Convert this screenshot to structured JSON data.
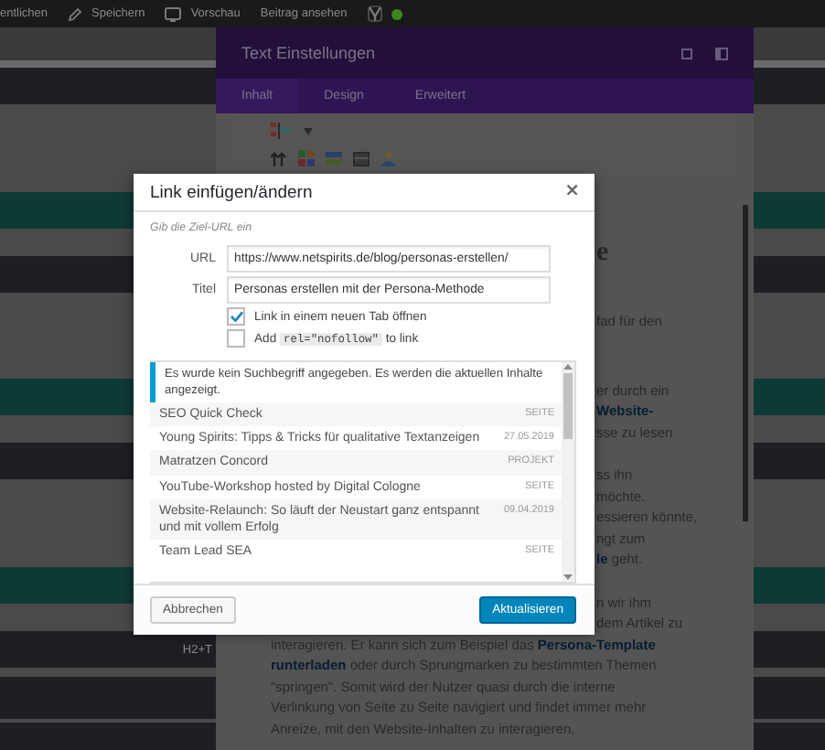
{
  "top_bar": {
    "items": [
      {
        "label": "entlichen"
      },
      {
        "label": "Speichern"
      },
      {
        "label": "Vorschau"
      },
      {
        "label": "Beitrag ansehen"
      }
    ]
  },
  "sidebar": {
    "label": "H2+T"
  },
  "settings_panel": {
    "title": "Text Einstellungen",
    "tabs": [
      {
        "label": "Inhalt",
        "selected": true
      },
      {
        "label": "Design",
        "selected": false
      },
      {
        "label": "Erweitert",
        "selected": false
      }
    ]
  },
  "editor": {
    "heading": "e",
    "paragraphs": [
      [
        {
          "kind": "fragment",
          "text": "fad für den"
        }
      ],
      [
        {
          "kind": "fragment",
          "text": "er durch ein"
        },
        {
          "kind": "fragment",
          "link": "Website-"
        },
        {
          "kind": "fragment",
          "text": "sse zu lesen"
        }
      ],
      [
        {
          "kind": "fragment",
          "text": "ss ihn"
        },
        {
          "kind": "fragment",
          "text": "möchte."
        },
        {
          "kind": "fragment",
          "text": "essieren könnte,"
        },
        {
          "kind": "fragment",
          "text": "ngt zum"
        },
        {
          "kind": "fragment",
          "link": "le",
          "after": " geht."
        }
      ],
      [
        {
          "kind": "fragment",
          "text": "n wir ihm"
        },
        {
          "kind": "fragment",
          "text": "dem Artikel zu"
        },
        {
          "kind": "full",
          "text": "interagieren. Er kann sich zum Beispiel das ",
          "link": "Persona-Template"
        },
        {
          "kind": "full",
          "link": "runterladen",
          "after": " oder durch Sprungmarken zu bestimmten Themen"
        },
        {
          "kind": "full",
          "text": "\"springen\". Somit wird der Nutzer quasi durch die interne"
        },
        {
          "kind": "full",
          "text": "Verlinkung von Seite zu Seite navigiert und findet immer mehr"
        },
        {
          "kind": "full",
          "text": "Anreize, mit den Website-Inhalten zu interagieren."
        }
      ]
    ]
  },
  "link_dialog": {
    "title": "Link einfügen/ändern",
    "close": "×",
    "hint": "Gib die Ziel-URL ein",
    "fields": [
      {
        "label": "URL",
        "value": "https://www.netspirits.de/blog/personas-erstellen/"
      },
      {
        "label": "Titel",
        "value": "Personas erstellen mit der Persona-Methode"
      }
    ],
    "options": [
      {
        "checked": true,
        "label": "Link in einem neuen Tab öffnen"
      },
      {
        "checked": false,
        "label": "Add ",
        "code": "rel=\"nofollow\"",
        "after": " to link"
      }
    ],
    "notice": "Es wurde kein Suchbegriff angegeben. Es werden die aktuellen Inhalte angezeigt.",
    "results": [
      {
        "title": "SEO Quick Check",
        "meta": "SEITE"
      },
      {
        "title": "Young Spirits: Tipps & Tricks für qualitative Textanzeigen",
        "meta": "27.05.2019"
      },
      {
        "title": "Matratzen Concord",
        "meta": "PROJEKT"
      },
      {
        "title": "YouTube-Workshop hosted by Digital Cologne",
        "meta": "SEITE"
      },
      {
        "title": "Website-Relaunch: So läuft der Neustart ganz entspannt und mit vollem Erfolg",
        "meta": "09.04.2019"
      },
      {
        "title": "Team Lead SEA",
        "meta": "SEITE"
      }
    ],
    "buttons": [
      {
        "kind": "secondary",
        "label": "Abbrechen"
      },
      {
        "kind": "primary",
        "label": "Aktualisieren"
      }
    ]
  }
}
